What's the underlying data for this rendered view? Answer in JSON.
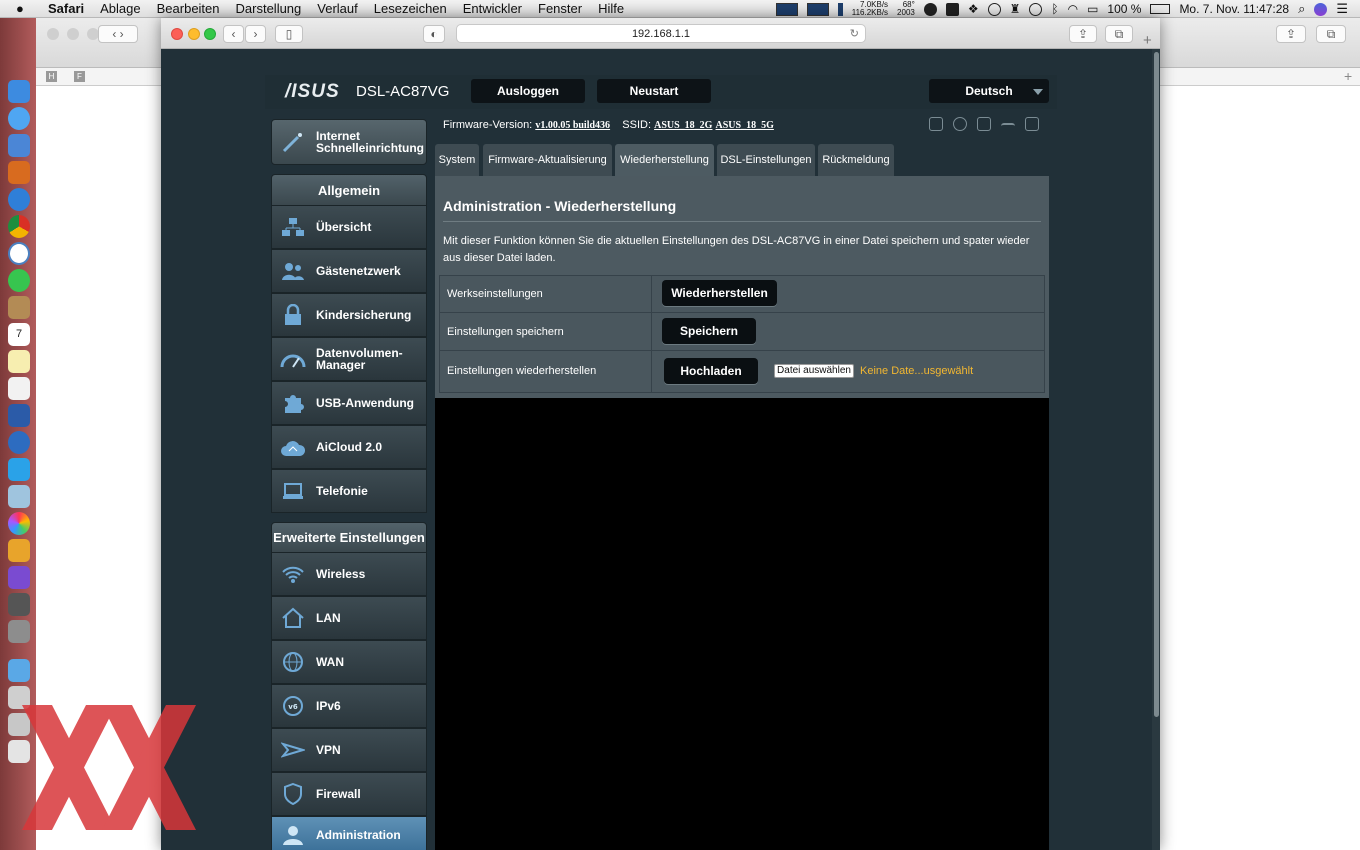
{
  "menubar": {
    "items": [
      "Safari",
      "Ablage",
      "Bearbeiten",
      "Darstellung",
      "Verlauf",
      "Lesezeichen",
      "Entwickler",
      "Fenster",
      "Hilfe"
    ],
    "net_up": "7.0KB/s",
    "net_down": "116.2KB/s",
    "temp": "68°",
    "rpm": "2003",
    "battery": "100 %",
    "clock": "Mo. 7. Nov.  11:47:28"
  },
  "browser": {
    "url": "192.168.1.1",
    "bg_tabs": [
      "H",
      "F"
    ]
  },
  "router": {
    "logo": "/ISUS",
    "model": "DSL-AC87VG",
    "logout": "Ausloggen",
    "restart": "Neustart",
    "language": "Deutsch",
    "fw_label": "Firmware-Version:",
    "fw_value": "v1.00.05 build436",
    "ssid_label": "SSID:",
    "ssid_2g": "ASUS_18_2G",
    "ssid_5g": "ASUS_18_5G",
    "quick_setup": "Internet Schnelleinrichtung",
    "general_header": "Allgemein",
    "general_items": [
      "Übersicht",
      "Gästenetzwerk",
      "Kindersicherung",
      "Datenvolumen-Manager",
      "USB-Anwendung",
      "AiCloud 2.0",
      "Telefonie"
    ],
    "advanced_header": "Erweiterte Einstellungen",
    "advanced_items": [
      "Wireless",
      "LAN",
      "WAN",
      "IPv6",
      "VPN",
      "Firewall",
      "Administration"
    ],
    "tabs": [
      "System",
      "Firmware-Aktualisierung",
      "Wiederherstellung",
      "DSL-Einstellungen",
      "Rückmeldung"
    ],
    "selected_tab": "Wiederherstellung",
    "panel_title": "Administration - Wiederherstellung",
    "panel_desc": "Mit dieser Funktion können Sie die aktuellen Einstellungen des DSL-AC87VG in einer Datei speichern und spater wieder aus dieser Datei laden.",
    "rows": [
      {
        "label": "Werkseinstellungen",
        "button": "Wiederherstellen"
      },
      {
        "label": "Einstellungen speichern",
        "button": "Speichern"
      },
      {
        "label": "Einstellungen wiederherstellen",
        "button": "Hochladen"
      }
    ],
    "file_button": "Datei auswählen",
    "file_status": "Keine Date...usgewählt"
  },
  "colors": {
    "accent_active": "#4a7ea6",
    "file_status": "#f2b731",
    "page_bg": "#213038"
  }
}
